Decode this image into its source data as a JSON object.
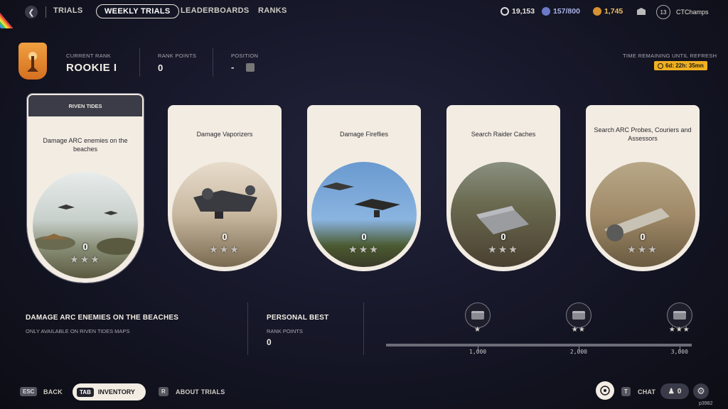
{
  "nav": {
    "trials": "TRIALS",
    "weekly_trials": "WEEKLY TRIALS",
    "leaderboards": "LEADERBOARDS",
    "ranks": "RANKS"
  },
  "currencies": {
    "coins": "19,153",
    "raider_tokens": "157/800",
    "cred": "1,745"
  },
  "player": {
    "level": "13",
    "name": "CTChamps"
  },
  "rank": {
    "current_rank_label": "CURRENT RANK",
    "current_rank": "ROOKIE I",
    "rank_points_label": "RANK POINTS",
    "rank_points": "0",
    "position_label": "POSITION",
    "position": "-"
  },
  "refresh": {
    "label": "TIME REMAINING UNTIL REFRESH",
    "time": "6d: 22h: 35mn"
  },
  "cards": [
    {
      "header": "RIVEN TIDES",
      "title": "Damage ARC enemies on the beaches",
      "score": "0",
      "stars": "★★★"
    },
    {
      "title": "Damage Vaporizers",
      "score": "0",
      "stars": "★★★"
    },
    {
      "title": "Damage Fireflies",
      "score": "0",
      "stars": "★★★"
    },
    {
      "title": "Search Raider Caches",
      "score": "0",
      "stars": "★★★"
    },
    {
      "title": "Search ARC Probes, Couriers and Assessors",
      "score": "0",
      "stars": "★★★"
    }
  ],
  "detail": {
    "title": "DAMAGE ARC ENEMIES ON THE BEACHES",
    "subtitle": "ONLY AVAILABLE ON RIVEN TIDES MAPS"
  },
  "personal_best": {
    "title": "PERSONAL BEST",
    "label": "RANK POINTS",
    "value": "0"
  },
  "milestones": [
    {
      "stars": "★",
      "value": "1,000",
      "fraction": 0.3
    },
    {
      "stars": "★★",
      "value": "2,000",
      "fraction": 0.63
    },
    {
      "stars": "★★★",
      "value": "3,000",
      "fraction": 0.96
    }
  ],
  "footer": {
    "esc_key": "ESC",
    "back": "BACK",
    "tab_key": "TAB",
    "inventory": "INVENTORY",
    "r_key": "R",
    "about": "ABOUT TRIALS",
    "t_key": "T",
    "chat": "CHAT",
    "friends_count": "0",
    "build": "p3982"
  },
  "colors": {
    "accent": "#f0b020",
    "card": "#f3ece3",
    "rank_badge": "#e08a30"
  }
}
